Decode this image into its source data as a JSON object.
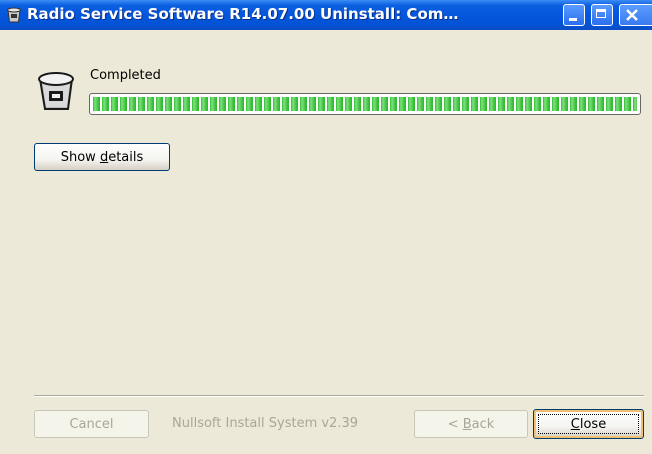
{
  "window": {
    "title": "Radio Service Software R14.07.00 Uninstall: Com…",
    "controls": {
      "minimize": "minimize",
      "maximize": "maximize",
      "close": "close"
    }
  },
  "status": {
    "label": "Completed",
    "progress_percent": 100,
    "progress_color": "#2fbd2f"
  },
  "buttons": {
    "show_details": {
      "pre": "Show ",
      "mnemonic": "d",
      "post": "etails"
    },
    "cancel": {
      "label": "Cancel",
      "enabled": false
    },
    "back": {
      "pre": "< ",
      "mnemonic": "B",
      "post": "ack",
      "enabled": false
    },
    "close": {
      "pre": "",
      "mnemonic": "C",
      "post": "lose",
      "enabled": true
    }
  },
  "branding": "Nullsoft Install System v2.39",
  "icons": {
    "title_icon": "recycle-bin-icon",
    "header_icon": "recycle-bin-icon"
  },
  "colors": {
    "titlebar": "#0556dc",
    "background": "#ece9d8"
  }
}
